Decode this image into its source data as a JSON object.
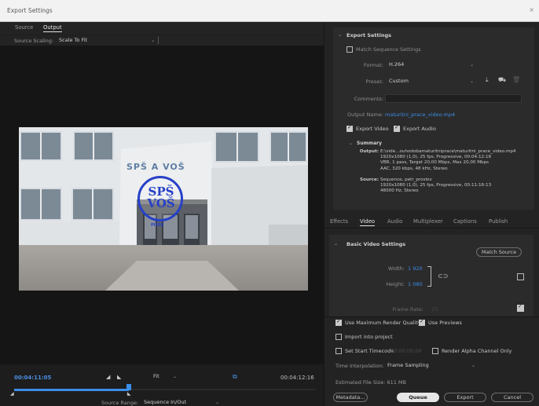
{
  "window": {
    "title": "Export Settings",
    "close": "×"
  },
  "left": {
    "tabs": [
      "Source",
      "Output"
    ],
    "source_scaling_label": "Source Scaling:",
    "source_scaling_value": "Scale To Fit",
    "video_text": {
      "school_text": "SPŠ A VOŠ",
      "logo_text": "SPŠ VOŠ",
      "logo_sub": "PÍSEK"
    },
    "timeline": {
      "current_time": "00:04:11:05",
      "fit_label": "Fit",
      "end_time": "00:04:12:16",
      "playhead_fraction": 0.38,
      "source_range_label": "Source Range:",
      "source_range_value": "Sequence In/Out"
    }
  },
  "export_settings": {
    "header": "Export Settings",
    "match_sequence": "Match Sequence Settings",
    "format_label": "Format:",
    "format_value": "H.264",
    "preset_label": "Preset:",
    "preset_value": "Custom",
    "comments_label": "Comments:",
    "output_name_label": "Output Name:",
    "output_name_value": "maturitni_prace_video.mp4",
    "export_video": "Export Video",
    "export_audio": "Export Audio",
    "summary_header": "Summary",
    "output_label": "Output:",
    "output_lines": [
      "E:\\vide...ouhodobamaturitniprace\\maturitni_prace_video.mp4",
      "1920x1080 (1,0), 25 fps, Progressive, 00:04:12:16",
      "VBR, 1 pass, Target 20,00 Mbps, Max 20,00 Mbps",
      "AAC, 320 kbps, 48 kHz, Stereo"
    ],
    "source_label": "Source:",
    "source_lines": [
      "Sequence, petr_proslov",
      "1920x1080 (1,0), 25 fps, Progressive, 00:11:16:13",
      "48000 Hz, Stereo"
    ]
  },
  "settings_tabs": [
    "Effects",
    "Video",
    "Audio",
    "Multiplexer",
    "Captions",
    "Publish"
  ],
  "video_settings": {
    "header": "Basic Video Settings",
    "match_source": "Match Source",
    "width_label": "Width:",
    "width_value": "1 920",
    "height_label": "Height:",
    "height_value": "1 080",
    "frame_rate_label": "Frame Rate:",
    "frame_rate_value": "25"
  },
  "bottom": {
    "max_render_quality": "Use Maximum Render Quality",
    "use_previews": "Use Previews",
    "import_into_project": "Import into project",
    "set_start_timecode": "Set Start Timecode",
    "start_timecode_value": "00:00:00:00",
    "render_alpha": "Render Alpha Channel Only",
    "time_interp_label": "Time Interpolation:",
    "time_interp_value": "Frame Sampling",
    "file_size": "Estimated File Size: 611 MB",
    "metadata": "Metadata...",
    "queue": "Queue",
    "export": "Export",
    "cancel": "Cancel"
  },
  "colors": {
    "accent": "#3b8ee8",
    "timecode": "#4a8fe0"
  }
}
